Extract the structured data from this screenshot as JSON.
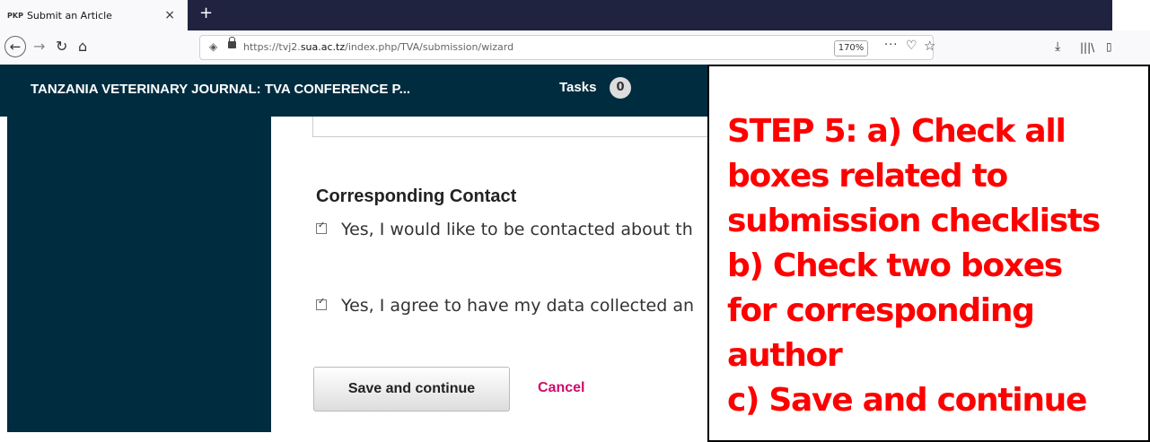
{
  "browser": {
    "tab_favicon": "PKP",
    "tab_title": "Submit an Article",
    "tab_close": "×",
    "new_tab": "+",
    "url_prefix": "https://tvj2.",
    "url_domain": "sua.ac.tz",
    "url_path": "/index.php/TVA/submission/wizard",
    "zoom": "170%"
  },
  "header": {
    "journal_title": "TANZANIA VETERINARY JOURNAL: TVA CONFERENCE P...",
    "tasks_label": "Tasks",
    "tasks_count": "0"
  },
  "main": {
    "section_title": "Corresponding Contact",
    "checkbox_contact_label": "Yes, I would like to be contacted about th",
    "checkbox_data_label": "Yes, I agree to have my data collected an",
    "save_button": "Save and continue",
    "cancel_link": "Cancel"
  },
  "annotation": {
    "lines": [
      "STEP 5: a) Check all",
      "boxes related to",
      "submission checklists",
      "b) Check two boxes",
      "for corresponding",
      "author",
      "c) Save and continue"
    ],
    "color": "#ff0000"
  },
  "colors": {
    "header_bg": "#002c40",
    "cancel_link": "#d00a6c"
  }
}
